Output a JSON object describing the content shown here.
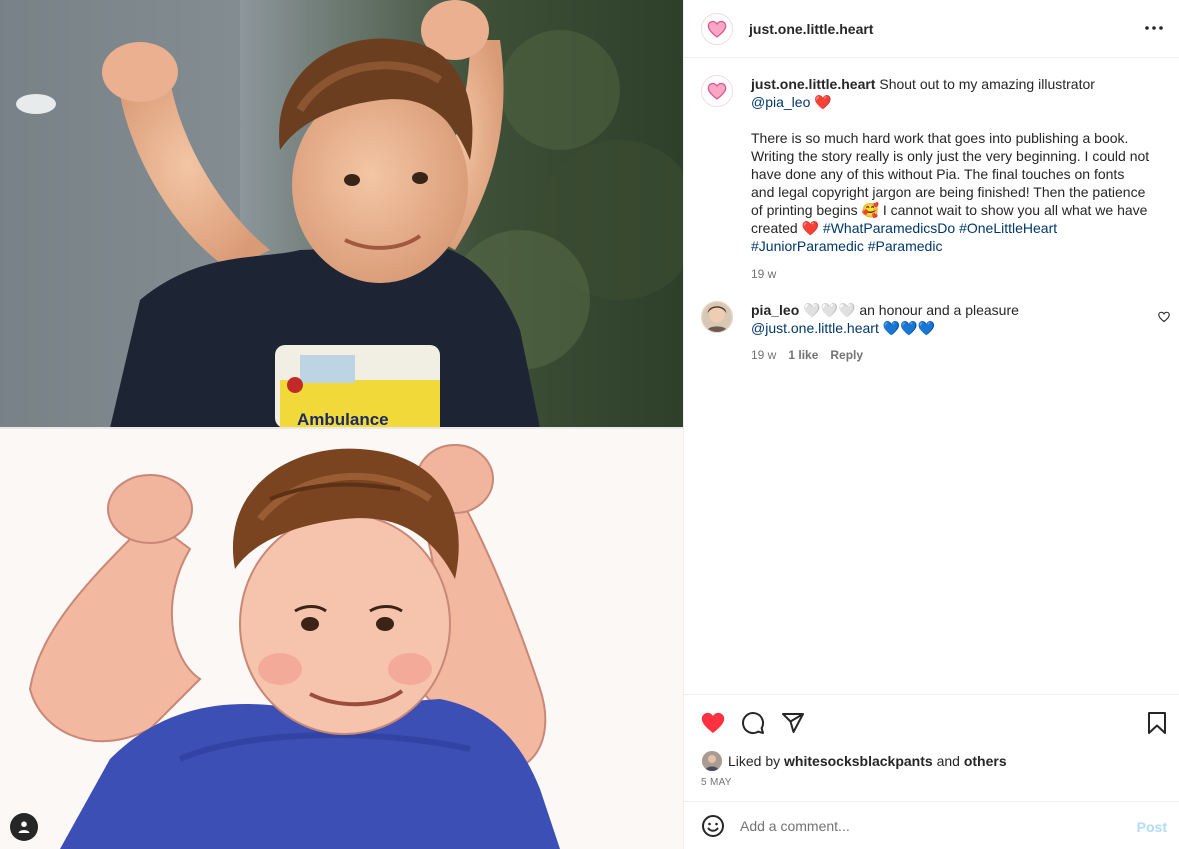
{
  "post": {
    "username": "just.one.little.heart",
    "more_icon": "more-horizontal-icon"
  },
  "caption": {
    "username": "just.one.little.heart",
    "line1": "Shout out to my amazing illustrator",
    "mention": "@pia_leo",
    "heart1": "❤️",
    "body": "There is so much hard work that goes into publishing a book. Writing the story really is only just the very beginning. I could not have done any of this without Pia. The final touches on fonts and legal copyright jargon are being finished! Then the patience of printing begins",
    "emoji_smile": "🥰",
    "body2": "I cannot wait to show you all what we have created",
    "heart2": "❤️",
    "hashtags": [
      "#WhatParamedicsDo",
      "#OneLittleHeart",
      "#JuniorParamedic",
      "#Paramedic"
    ],
    "time": "19 w"
  },
  "comment": {
    "username": "pia_leo",
    "hearts_white": "🤍🤍🤍",
    "text": "an honour and a pleasure",
    "mention": "@just.one.little.heart",
    "hearts_blue": "💙💙💙",
    "time": "19 w",
    "likes": "1 like",
    "reply": "Reply"
  },
  "actions": {
    "like_icon": "heart-filled-icon",
    "comment_icon": "comment-icon",
    "share_icon": "share-icon",
    "save_icon": "bookmark-icon",
    "liked_by_prefix": "Liked by",
    "liked_by_user": "whitesocksblackpants",
    "liked_by_and": "and",
    "liked_by_others": "others",
    "date": "5 MAY"
  },
  "comment_box": {
    "placeholder": "Add a comment...",
    "post_label": "Post"
  },
  "media": {
    "shirt_text": "Ambulance"
  },
  "colors": {
    "like_red": "#ff3040",
    "link_blue": "#00376b",
    "post_disabled": "#b3dbff",
    "muted_text": "#737373"
  }
}
